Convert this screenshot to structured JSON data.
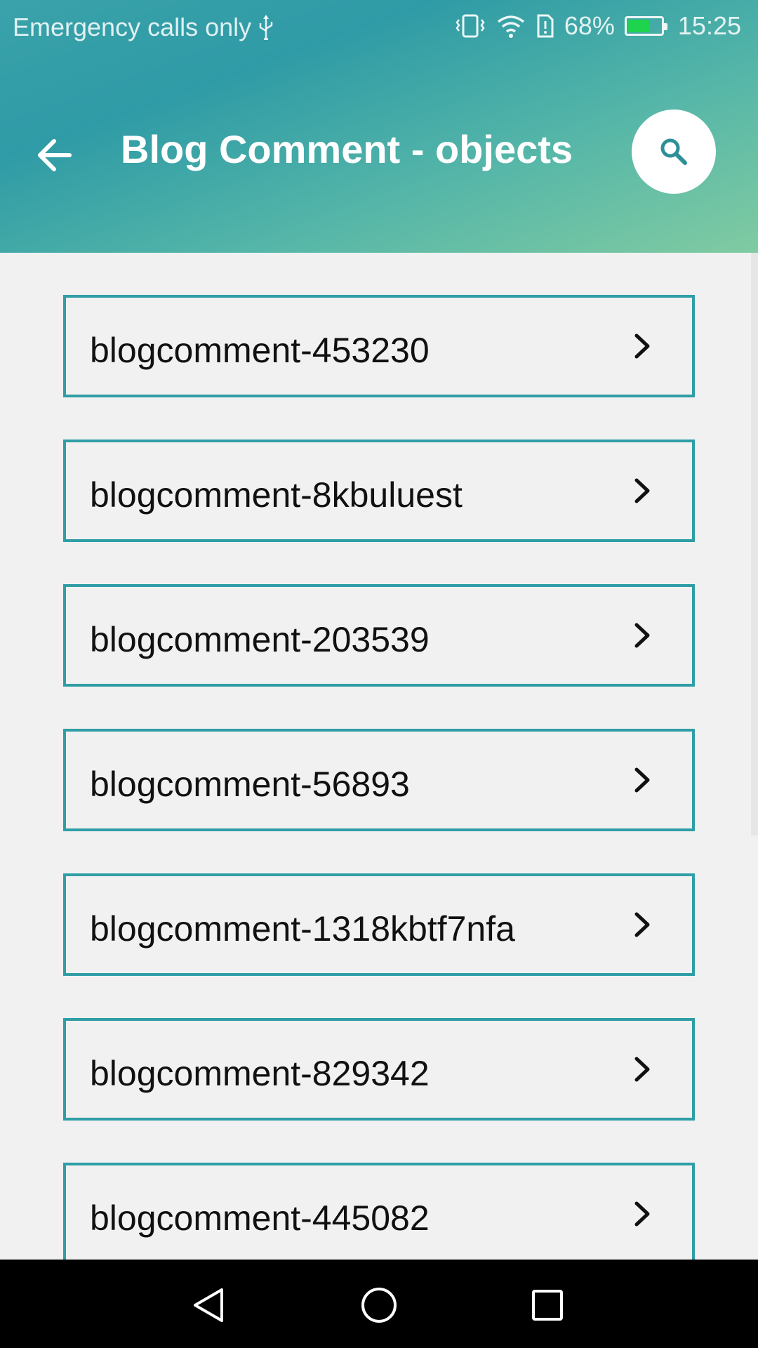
{
  "status_bar": {
    "carrier_text": "Emergency calls only",
    "battery_percent": "68%",
    "battery_level": 0.68,
    "time": "15:25",
    "icons": [
      "usb-icon",
      "vibrate-icon",
      "wifi-icon",
      "sim-alert-icon",
      "battery-charging-icon"
    ]
  },
  "app_bar": {
    "title": "Blog Comment - objects",
    "back_icon": "arrow-left-icon",
    "search_icon": "search-icon"
  },
  "list": {
    "items": [
      {
        "label": "blogcomment-453230"
      },
      {
        "label": "blogcomment-8kbuluest"
      },
      {
        "label": "blogcomment-203539"
      },
      {
        "label": "blogcomment-56893"
      },
      {
        "label": "blogcomment-1318kbtf7nfa"
      },
      {
        "label": "blogcomment-829342"
      },
      {
        "label": "blogcomment-445082"
      }
    ]
  },
  "nav_bar": {
    "icons": [
      "back-triangle-icon",
      "home-circle-icon",
      "recents-square-icon"
    ]
  },
  "colors": {
    "accent": "#2f9ea6",
    "gradient_start": "#3aa2aa",
    "gradient_end": "#80cba2",
    "background": "#f1f1f1",
    "battery_green": "#1ed34e"
  }
}
